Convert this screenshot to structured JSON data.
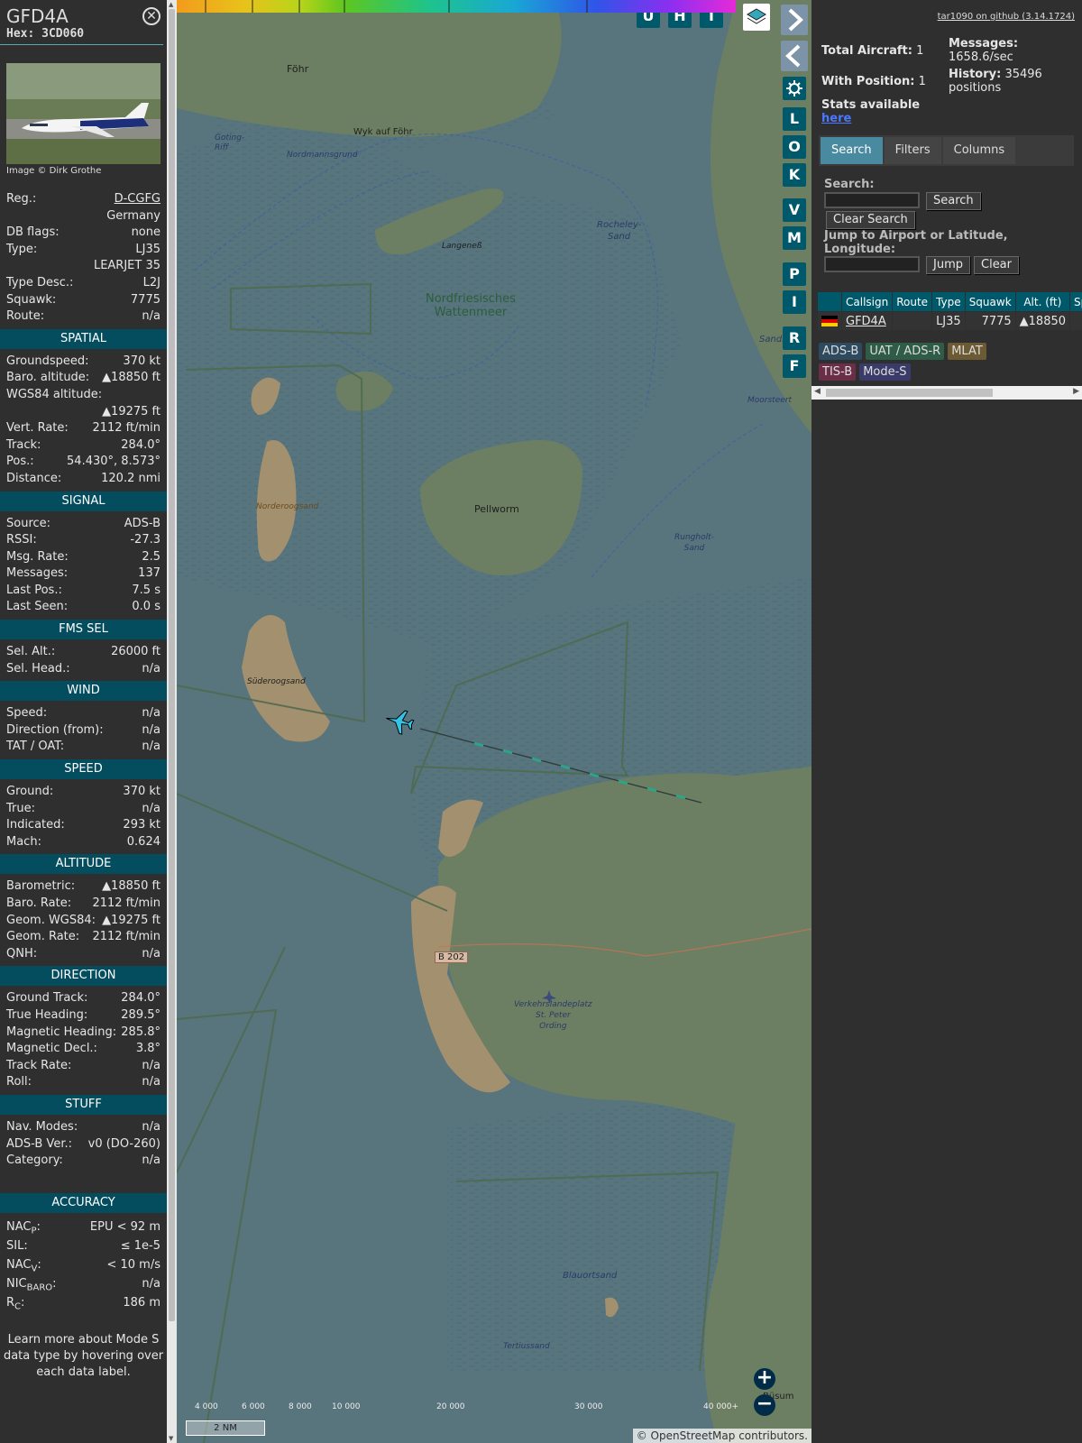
{
  "infoblock": {
    "callsign": "GFD4A",
    "hex_label": "Hex:",
    "hex": "3CD060",
    "close_icon": "close-icon",
    "photo_credit": "Image © Dirk Grothe",
    "basic": [
      {
        "k": "Reg.:",
        "v": "D-CGFG",
        "link": true
      },
      {
        "k": "",
        "v": "Germany"
      },
      {
        "k": "DB flags:",
        "v": "none"
      },
      {
        "k": "Type:",
        "v": "LJ35"
      },
      {
        "k": "",
        "v": "LEARJET 35"
      },
      {
        "k": "Type Desc.:",
        "v": "L2J"
      },
      {
        "k": "Squawk:",
        "v": "7775"
      },
      {
        "k": "Route:",
        "v": "n/a"
      }
    ],
    "sections": [
      {
        "title": "SPATIAL",
        "rows": [
          {
            "k": "Groundspeed:",
            "v": "370 kt"
          },
          {
            "k": "Baro. altitude:",
            "v": "▲18850 ft"
          },
          {
            "k": "WGS84 altitude:",
            "v": ""
          },
          {
            "k": "",
            "v": "▲19275 ft"
          },
          {
            "k": "Vert. Rate:",
            "v": "2112 ft/min"
          },
          {
            "k": "Track:",
            "v": "284.0°"
          },
          {
            "k": "Pos.:",
            "v": "54.430°, 8.573°"
          },
          {
            "k": "Distance:",
            "v": "120.2 nmi"
          }
        ]
      },
      {
        "title": "SIGNAL",
        "rows": [
          {
            "k": "Source:",
            "v": "ADS-B"
          },
          {
            "k": "RSSI:",
            "v": "-27.3"
          },
          {
            "k": "Msg. Rate:",
            "v": "2.5"
          },
          {
            "k": "Messages:",
            "v": "137"
          },
          {
            "k": "Last Pos.:",
            "v": "7.5 s"
          },
          {
            "k": "Last Seen:",
            "v": "0.0 s"
          }
        ]
      },
      {
        "title": "FMS SEL",
        "rows": [
          {
            "k": "Sel. Alt.:",
            "v": "26000 ft"
          },
          {
            "k": "Sel. Head.:",
            "v": "n/a"
          }
        ]
      },
      {
        "title": "WIND",
        "rows": [
          {
            "k": "Speed:",
            "v": "n/a"
          },
          {
            "k": "Direction (from):",
            "v": "n/a"
          },
          {
            "k": "TAT / OAT:",
            "v": "n/a"
          }
        ]
      },
      {
        "title": "SPEED",
        "rows": [
          {
            "k": "Ground:",
            "v": "370 kt"
          },
          {
            "k": "True:",
            "v": "n/a"
          },
          {
            "k": "Indicated:",
            "v": "293 kt"
          },
          {
            "k": "Mach:",
            "v": "0.624"
          }
        ]
      },
      {
        "title": "ALTITUDE",
        "rows": [
          {
            "k": "Barometric:",
            "v": "▲18850 ft"
          },
          {
            "k": "Baro. Rate:",
            "v": "2112 ft/min"
          },
          {
            "k": "Geom. WGS84:",
            "v": "▲19275 ft"
          },
          {
            "k": "Geom. Rate:",
            "v": "2112 ft/min"
          },
          {
            "k": "QNH:",
            "v": "n/a"
          }
        ]
      },
      {
        "title": "DIRECTION",
        "rows": [
          {
            "k": "Ground Track:",
            "v": "284.0°"
          },
          {
            "k": "True Heading:",
            "v": "289.5°"
          },
          {
            "k": "Magnetic Heading:",
            "v": "285.8°"
          },
          {
            "k": "Magnetic Decl.:",
            "v": "3.8°"
          },
          {
            "k": "Track Rate:",
            "v": "n/a"
          },
          {
            "k": "Roll:",
            "v": "n/a"
          }
        ]
      },
      {
        "title": "STUFF",
        "rows": [
          {
            "k": "Nav. Modes:",
            "v": "n/a"
          },
          {
            "k": "ADS-B Ver.:",
            "v": "v0 (DO-260)"
          },
          {
            "k": "Category:",
            "v": "n/a"
          }
        ]
      }
    ],
    "accuracy": {
      "title": "ACCURACY",
      "rows": [
        {
          "k": "NAC",
          "sub": "P",
          "v": "EPU < 92 m"
        },
        {
          "k": "SIL:",
          "sub": "",
          "v": "≤ 1e-5"
        },
        {
          "k": "NAC",
          "sub": "V",
          "v": "< 10 m/s"
        },
        {
          "k": "NIC",
          "sub": "BARO",
          "v": "n/a"
        },
        {
          "k": "R",
          "sub": "C",
          "v": "186 m"
        }
      ]
    },
    "note": "Learn more about Mode S data type by hovering over each data label."
  },
  "map": {
    "labels": {
      "fohr": "Föhr",
      "wyk": "Wyk auf Föhr",
      "goting": "Goting-\nRiff",
      "nordmannsgrund": "Nordmannsgrund",
      "langeness": "Langeneß",
      "rocheley": "Rocheley-\nSand",
      "wattenmeer": "Nordfriesisches\nWattenmeer",
      "sandl": "Sandl",
      "moorsteert": "Moorsteert",
      "norderoogsand": "Norderoogsand",
      "pellworm": "Pellworm",
      "rungholt": "Rungholt-\nSand",
      "suderoogsand": "Süderoogsand",
      "b202": "B 202",
      "airfield": "Verkehrslandeplatz\nSt. Peter\nOrding",
      "blauortsand": "Blauortsand",
      "tertiussand": "Tertiussand",
      "busum": "Büsum"
    },
    "buttons": {
      "u": "U",
      "h": "H",
      "t": "T",
      "l": "L",
      "o": "O",
      "k": "K",
      "v": "V",
      "m": "M",
      "p": "P",
      "i": "I",
      "r": "R",
      "f": "F"
    },
    "layers_icon": "layers-icon",
    "expand_icon": "chevron-right-icon",
    "collapse_icon": "chevron-left-icon",
    "settings_icon": "gear-icon",
    "split_icon": "split-arrows-icon",
    "zoom_in": "+",
    "zoom_out": "−",
    "scale": "2 NM",
    "attribution_prefix": "© ",
    "attribution_link": "OpenStreetMap",
    "attribution_suffix": " contributors.",
    "alt_ticks": [
      "4 000",
      "6 000",
      "8 000",
      "10 000",
      "20 000",
      "30 000",
      "40 000+"
    ],
    "colors": {
      "water": "#58747d",
      "land": "#6d7f62",
      "sand": "#a3906e",
      "track": "#2f3a3a",
      "plane": "#34c3e6"
    }
  },
  "sidebar": {
    "github_link": "tar1090 on github (3.14.1724)",
    "total_aircraft_label": "Total Aircraft:",
    "total_aircraft": "1",
    "with_position_label": "With Position:",
    "with_position": "1",
    "stats_label": "Stats available",
    "stats_link": "here",
    "messages_label": "Messages:",
    "messages_rate": "1658.6/sec",
    "history_label": "History:",
    "history_value": "35496",
    "history_unit": "positions",
    "tabs": [
      "Search",
      "Filters",
      "Columns"
    ],
    "search_label": "Search:",
    "search_button": "Search",
    "clear_search_button": "Clear Search",
    "jump_label": "Jump to Airport or Latitude, Longitude:",
    "jump_button": "Jump",
    "clear_button": "Clear",
    "table_headers": [
      "",
      "Callsign",
      "Route",
      "Type",
      "Squawk",
      "Alt. (ft)",
      "Spd"
    ],
    "table_rows": [
      {
        "flag": "de-flag-icon",
        "callsign": "GFD4A",
        "route": "",
        "type": "LJ35",
        "squawk": "7775",
        "alt": "▲18850",
        "spd": ""
      }
    ],
    "legend": [
      {
        "label": "ADS-B",
        "color": "#2d4a5f"
      },
      {
        "label": "UAT / ADS-R",
        "color": "#2f5c46"
      },
      {
        "label": "MLAT",
        "color": "#6b5a33"
      },
      {
        "label": "TIS-B",
        "color": "#6a2f47"
      },
      {
        "label": "Mode-S",
        "color": "#3b3b6a"
      }
    ]
  }
}
